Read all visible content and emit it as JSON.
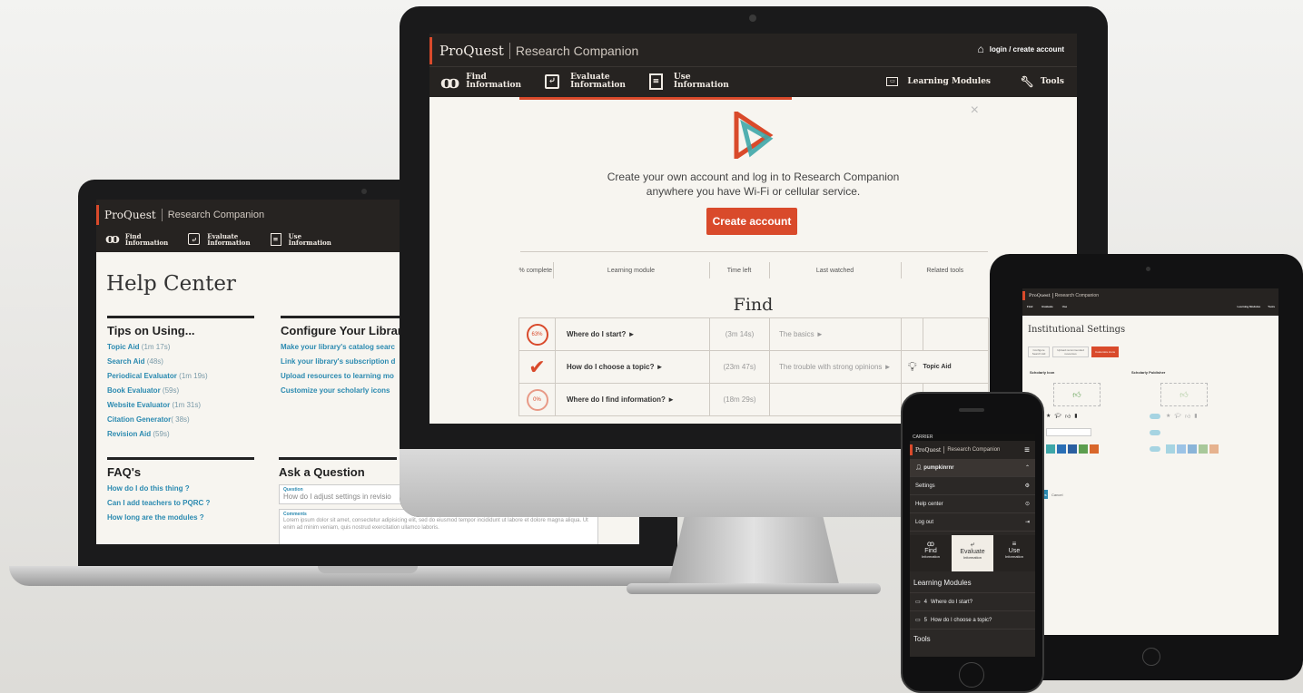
{
  "brand": {
    "name": "ProQuest",
    "product": "Research Companion"
  },
  "colors": {
    "accent": "#d94a2b",
    "header": "#262321",
    "link": "#2b8ab0",
    "teal": "#3ea7a8"
  },
  "nav": {
    "find": [
      "Find",
      "Information"
    ],
    "evaluate": [
      "Evaluate",
      "Information"
    ],
    "use": [
      "Use",
      "Information"
    ],
    "learning_modules": "Learning Modules",
    "tools": "Tools",
    "login": "login / create account"
  },
  "laptop": {
    "title": "Help Center",
    "tips": {
      "heading": "Tips on Using...",
      "items": [
        {
          "label": "Topic Aid",
          "time": "(1m 17s)"
        },
        {
          "label": "Search Aid",
          "time": "(48s)"
        },
        {
          "label": "Periodical Evaluator",
          "time": "(1m 19s)"
        },
        {
          "label": "Book Evaluator",
          "time": "(59s)"
        },
        {
          "label": "Website Evaluator",
          "time": "(1m 31s)"
        },
        {
          "label": "Citation Generator",
          "time": "( 38s)"
        },
        {
          "label": "Revision Aid",
          "time": "(59s)"
        }
      ]
    },
    "configure": {
      "heading": "Configure Your Librar",
      "items": [
        "Make your library's catalog searc",
        "Link your library's subscription d",
        "Upload resources to learning mo",
        "Customize your scholarly icons"
      ]
    },
    "faq": {
      "heading": "FAQ's",
      "items": [
        "How do I do this thing ?",
        "Can I add teachers to PQRC ?",
        "How long are the modules ?"
      ]
    },
    "ask": {
      "heading": "Ask a Question",
      "question_label": "Question",
      "question_value": "How do I adjust settings in revisio",
      "comments_label": "Comments",
      "comments_value": "Lorem ipsum dolor sit amet, consectetur adipisicing elit, sed do eiusmod tempor incididunt ut labore et dolore magna aliqua. Ut enim ad minim veniam, quis nostrud exercitation ullamco laboris."
    }
  },
  "monitor": {
    "message": [
      "Create your own account and log in to Research Companion",
      "anywhere you have Wi-Fi or cellular service."
    ],
    "cta": "Create account",
    "close": "×",
    "table": {
      "headers": [
        "% complete",
        "Learning module",
        "Time left",
        "Last watched",
        "Related tools"
      ],
      "section": "Find",
      "rows": [
        {
          "progress": "63%",
          "module": "Where do I start? ►",
          "time": "(3m 14s)",
          "last": "The basics ►",
          "tool": ""
        },
        {
          "progress": "✔",
          "module": "How do I choose a topic? ►",
          "time": "(23m 47s)",
          "last": "The trouble with strong opinions ►",
          "tool": "Topic Aid"
        },
        {
          "progress": "0%",
          "module": "Where do I find information? ►",
          "time": "(18m 29s)",
          "last": "",
          "tool": ""
        }
      ]
    }
  },
  "tablet": {
    "title": "Institutional Settings",
    "tabs": [
      "Configure Search Aid",
      "Upload recommended resources",
      "Customize icons"
    ],
    "scholarly_icon": "Scholarly Icon",
    "scholarly_publisher": "Scholarly Publisher",
    "save": "Save changes",
    "cancel": "Cancel",
    "swatches": [
      "#3ea7a8",
      "#2a6fb5",
      "#2b5fa0",
      "#5c9e4f",
      "#d9672b"
    ],
    "swatches_light": [
      "#a6d4e2",
      "#9cc3e6",
      "#8ab4d8",
      "#a8c89a",
      "#e6b28e"
    ]
  },
  "phone": {
    "carrier": "CARRIER",
    "user": "pumpkinrnr",
    "menu": [
      "Settings",
      "Help center",
      "Log out"
    ],
    "tabs": [
      [
        "Find",
        "Information"
      ],
      [
        "Evaluate",
        "Information"
      ],
      [
        "Use",
        "Information"
      ]
    ],
    "learning_modules": "Learning Modules",
    "modules": [
      {
        "num": "4",
        "label": "Where do I start?"
      },
      {
        "num": "5",
        "label": "How do I choose a topic?"
      }
    ],
    "tools": "Tools"
  }
}
